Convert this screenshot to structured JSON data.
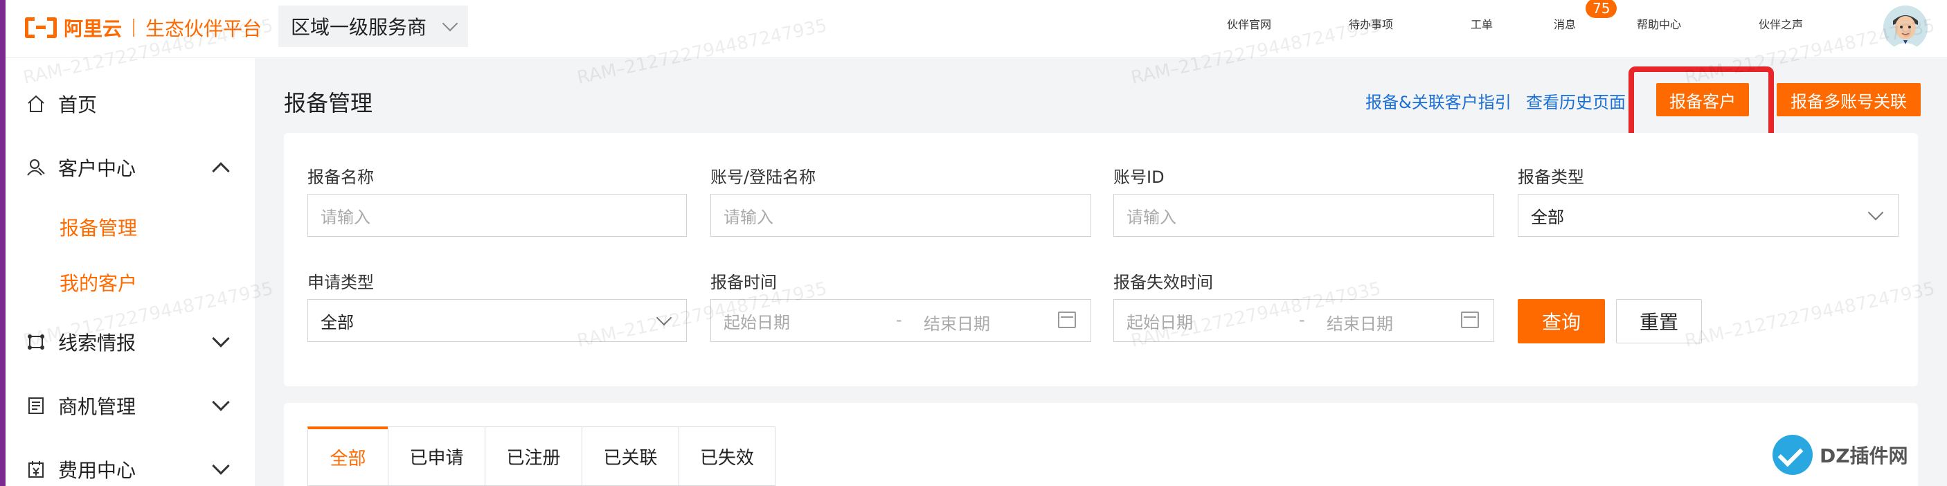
{
  "header": {
    "logo_text": "阿里云",
    "logo_subtitle": "生态伙伴平台",
    "region_value": "区域一级服务商",
    "nav": [
      "伙伴官网",
      "待办事项",
      "工单",
      "消息",
      "帮助中心",
      "伙伴之声"
    ],
    "message_badge": "75"
  },
  "sidebar": {
    "home": "首页",
    "customer_center": "客户中心",
    "sub_registration": "报备管理",
    "sub_my_customers": "我的客户",
    "leads": "线索情报",
    "opportunities": "商机管理",
    "costs": "费用中心"
  },
  "main": {
    "title": "报备管理",
    "link_guide": "报备&关联客户指引",
    "link_history": "查看历史页面",
    "btn_register": "报备客户",
    "btn_multi": "报备多账号关联"
  },
  "filters": {
    "name_label": "报备名称",
    "name_placeholder": "请输入",
    "account_label": "账号/登陆名称",
    "account_placeholder": "请输入",
    "id_label": "账号ID",
    "id_placeholder": "请输入",
    "type_label": "报备类型",
    "type_value": "全部",
    "apply_label": "申请类型",
    "apply_value": "全部",
    "time_label": "报备时间",
    "start_placeholder": "起始日期",
    "end_placeholder": "结束日期",
    "expire_label": "报备失效时间",
    "expire_start_placeholder": "起始日期",
    "expire_end_placeholder": "结束日期",
    "date_sep": "-",
    "query": "查询",
    "reset": "重置"
  },
  "tabs": [
    "全部",
    "已申请",
    "已注册",
    "已关联",
    "已失效"
  ],
  "watermark": "RAM–2127227944872479 35",
  "watermark_text": "RAM–212722794487247935",
  "corner_logo": "DZ插件网",
  "colors": {
    "accent": "#ff6a00",
    "link": "#1a6fd6",
    "highlight": "#e8262a"
  }
}
